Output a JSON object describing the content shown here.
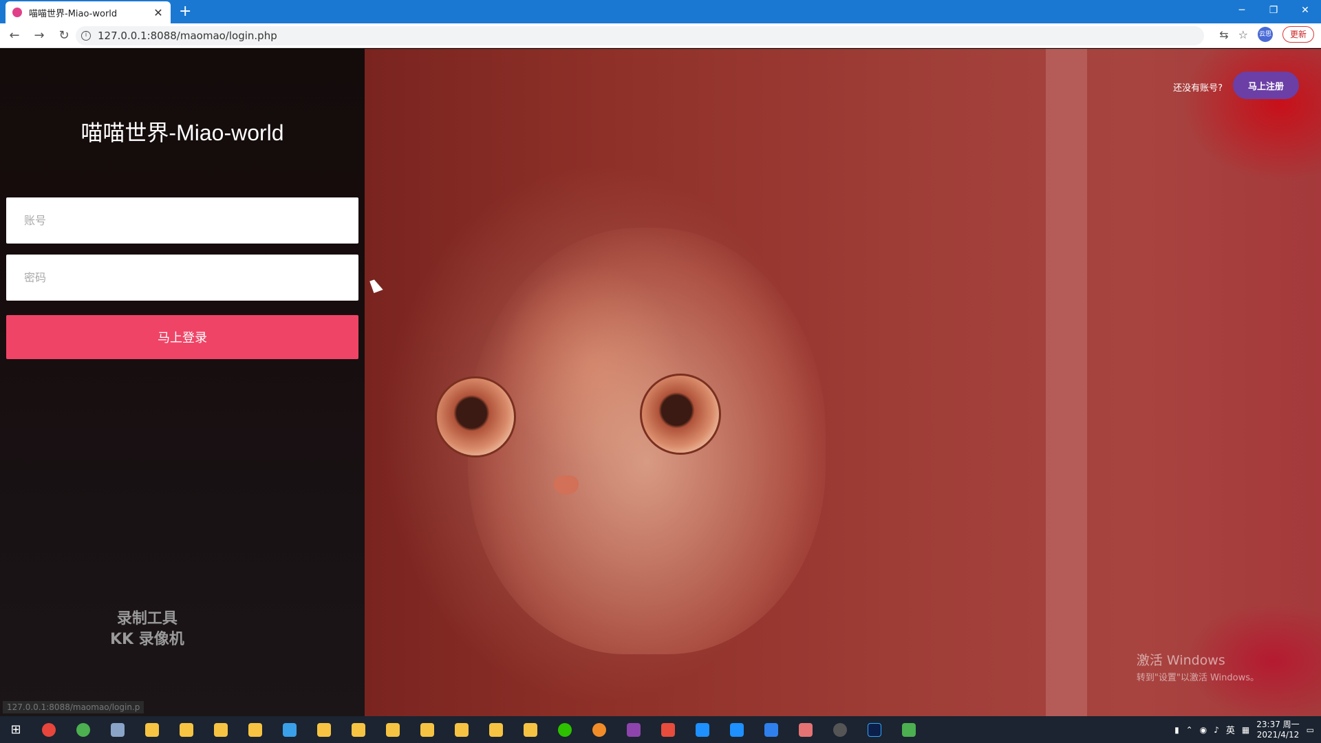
{
  "browser": {
    "tab_title": "喵喵世界-Miao-world",
    "tab_close": "✕",
    "new_tab": "+",
    "url": "127.0.0.1:8088/maomao/login.php",
    "update_label": "更新",
    "profile_label": "云思",
    "win_minimize": "─",
    "win_restore": "❐",
    "win_close": "✕"
  },
  "login": {
    "site_title": "喵喵世界-Miao-world",
    "username_placeholder": "账号",
    "password_placeholder": "密码",
    "login_button": "马上登录"
  },
  "header": {
    "signup_prompt": "还没有账号?",
    "signup_button": "马上注册"
  },
  "overlay": {
    "watermark_line1": "录制工具",
    "watermark_line2": "KK 录像机",
    "status_url": "127.0.0.1:8088/maomao/login.p",
    "activate_title": "激活 Windows",
    "activate_sub": "转到\"设置\"以激活 Windows。"
  },
  "taskbar": {
    "time": "23:37 周一",
    "date": "2021/4/12",
    "lang": "英"
  },
  "colors": {
    "login_button": "#ef4466",
    "signup_button": "#6b3fa6",
    "tabbar": "#1a78d2"
  }
}
